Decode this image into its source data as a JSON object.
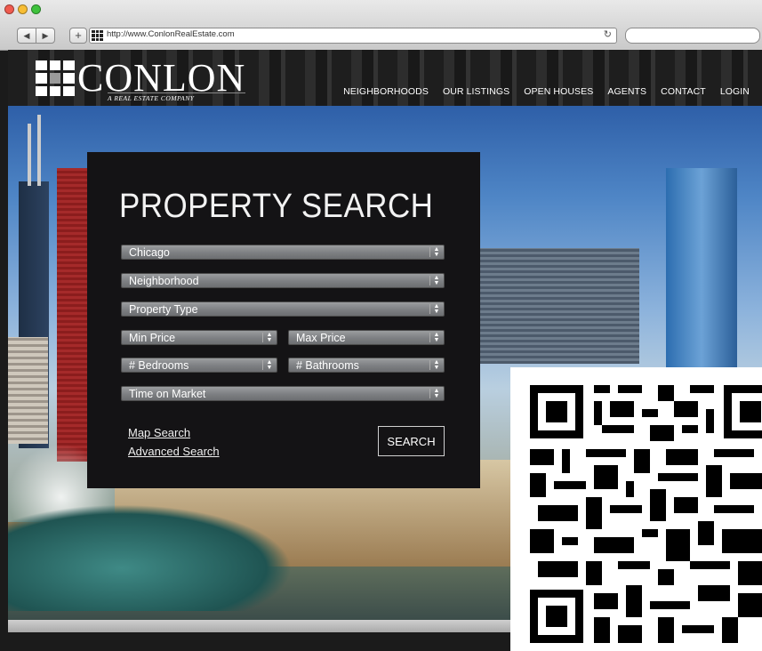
{
  "browser": {
    "url": "http://www.ConlonRealEstate.com",
    "back_icon": "back-arrow-icon",
    "forward_icon": "forward-arrow-icon",
    "new_tab_label": "+",
    "reload_icon": "reload-icon",
    "traffic_light_colors": [
      "#f05b4f",
      "#f7bd34",
      "#3ec23c"
    ]
  },
  "header": {
    "logo_name": "CONLON",
    "logo_tagline": "A REAL ESTATE COMPANY",
    "nav": [
      "NEIGHBORHOODS",
      "OUR LISTINGS",
      "OPEN HOUSES",
      "AGENTS",
      "CONTACT",
      "LOGIN"
    ]
  },
  "search_panel": {
    "title": "PROPERTY SEARCH",
    "city": "Chicago",
    "neighborhood": "Neighborhood",
    "property_type": "Property Type",
    "min_price": "Min Price",
    "max_price": "Max Price",
    "bedrooms": "# Bedrooms",
    "bathrooms": "# Bathrooms",
    "time_on_market": "Time on Market",
    "map_search": "Map Search",
    "advanced_search": "Advanced Search",
    "search_button": "SEARCH"
  },
  "colors": {
    "panel_bg": "#141315",
    "header_bg": "#1e1e1e",
    "select_gray": "#7d7f82"
  }
}
